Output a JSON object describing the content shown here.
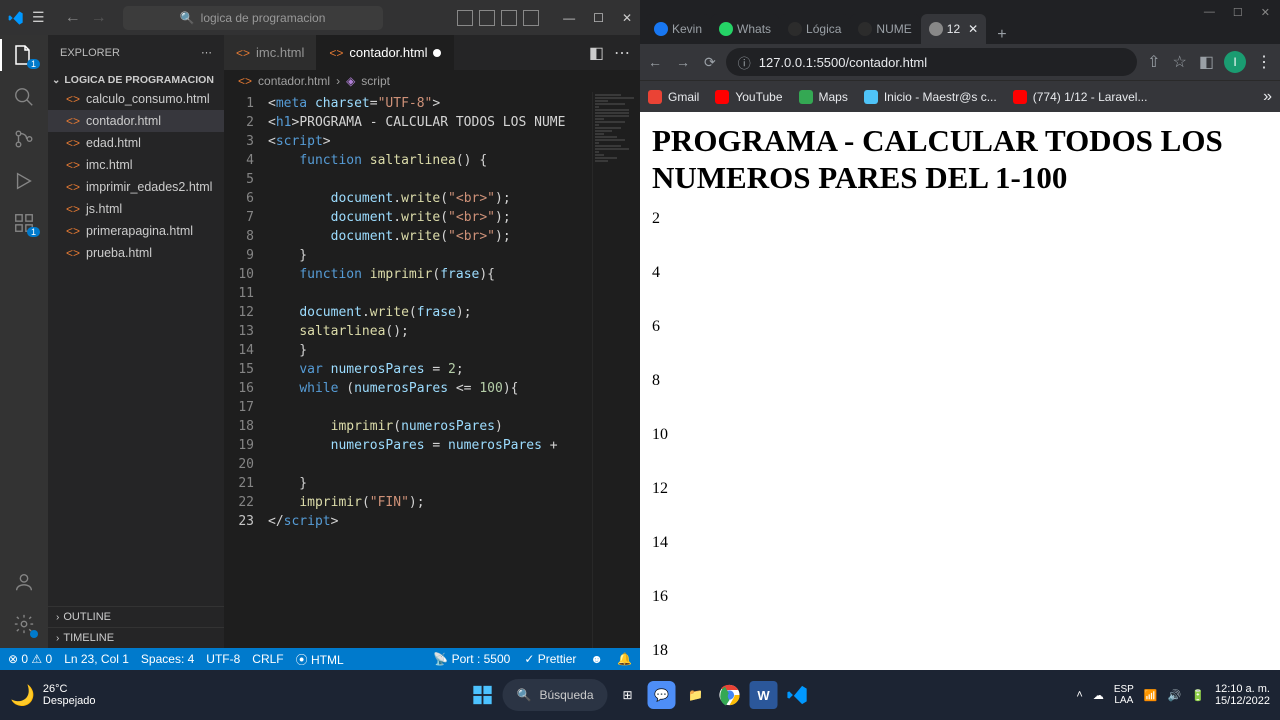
{
  "vscode": {
    "search_placeholder": "logica de programacion",
    "explorer_title": "EXPLORER",
    "folder_name": "LOGICA DE PROGRAMACION",
    "files": [
      {
        "name": "calculo_consumo.html"
      },
      {
        "name": "contador.html"
      },
      {
        "name": "edad.html"
      },
      {
        "name": "imc.html"
      },
      {
        "name": "imprimir_edades2.html"
      },
      {
        "name": "js.html"
      },
      {
        "name": "primerapagina.html"
      },
      {
        "name": "prueba.html"
      }
    ],
    "outline": "OUTLINE",
    "timeline": "TIMELINE",
    "tabs": [
      {
        "name": "imc.html",
        "active": false
      },
      {
        "name": "contador.html",
        "active": true,
        "dirty": true
      }
    ],
    "breadcrumb": {
      "file": "contador.html",
      "symbol": "script"
    },
    "statusbar": {
      "errors": "0",
      "warnings": "0",
      "cursor": "Ln 23, Col 1",
      "spaces": "Spaces: 4",
      "encoding": "UTF-8",
      "eol": "CRLF",
      "lang": "HTML",
      "port": "Port : 5500",
      "prettier": "Prettier"
    },
    "badge1": "1",
    "badge2": "1"
  },
  "browser": {
    "tabs": [
      {
        "label": "Kevin",
        "color": "#1877f2"
      },
      {
        "label": "Whats",
        "color": "#25d366"
      },
      {
        "label": "Lógica",
        "color": "#2c2c2c"
      },
      {
        "label": "NUME",
        "color": "#2c2c2c"
      },
      {
        "label": "12",
        "active": true,
        "close": true,
        "color": "#888"
      }
    ],
    "url": "127.0.0.1:5500/contador.html",
    "bookmarks": [
      {
        "label": "Gmail",
        "color": "#ea4335"
      },
      {
        "label": "YouTube",
        "color": "#ff0000"
      },
      {
        "label": "Maps",
        "color": "#34a853"
      },
      {
        "label": "Inicio - Maestr@s c...",
        "color": "#4fc3f7"
      },
      {
        "label": "(774) 1/12 - Laravel...",
        "color": "#ff0000"
      }
    ],
    "avatar": "I",
    "page": {
      "heading": "PROGRAMA - CALCULAR TODOS LOS NUMEROS PARES DEL 1-100",
      "lines": [
        "2",
        "4",
        "6",
        "8",
        "10",
        "12",
        "14",
        "16",
        "18"
      ]
    }
  },
  "taskbar": {
    "temp": "26°C",
    "weather": "Despejado",
    "search": "Búsqueda",
    "lang1": "ESP",
    "lang2": "LAA",
    "time": "12:10 a. m.",
    "date": "15/12/2022"
  }
}
